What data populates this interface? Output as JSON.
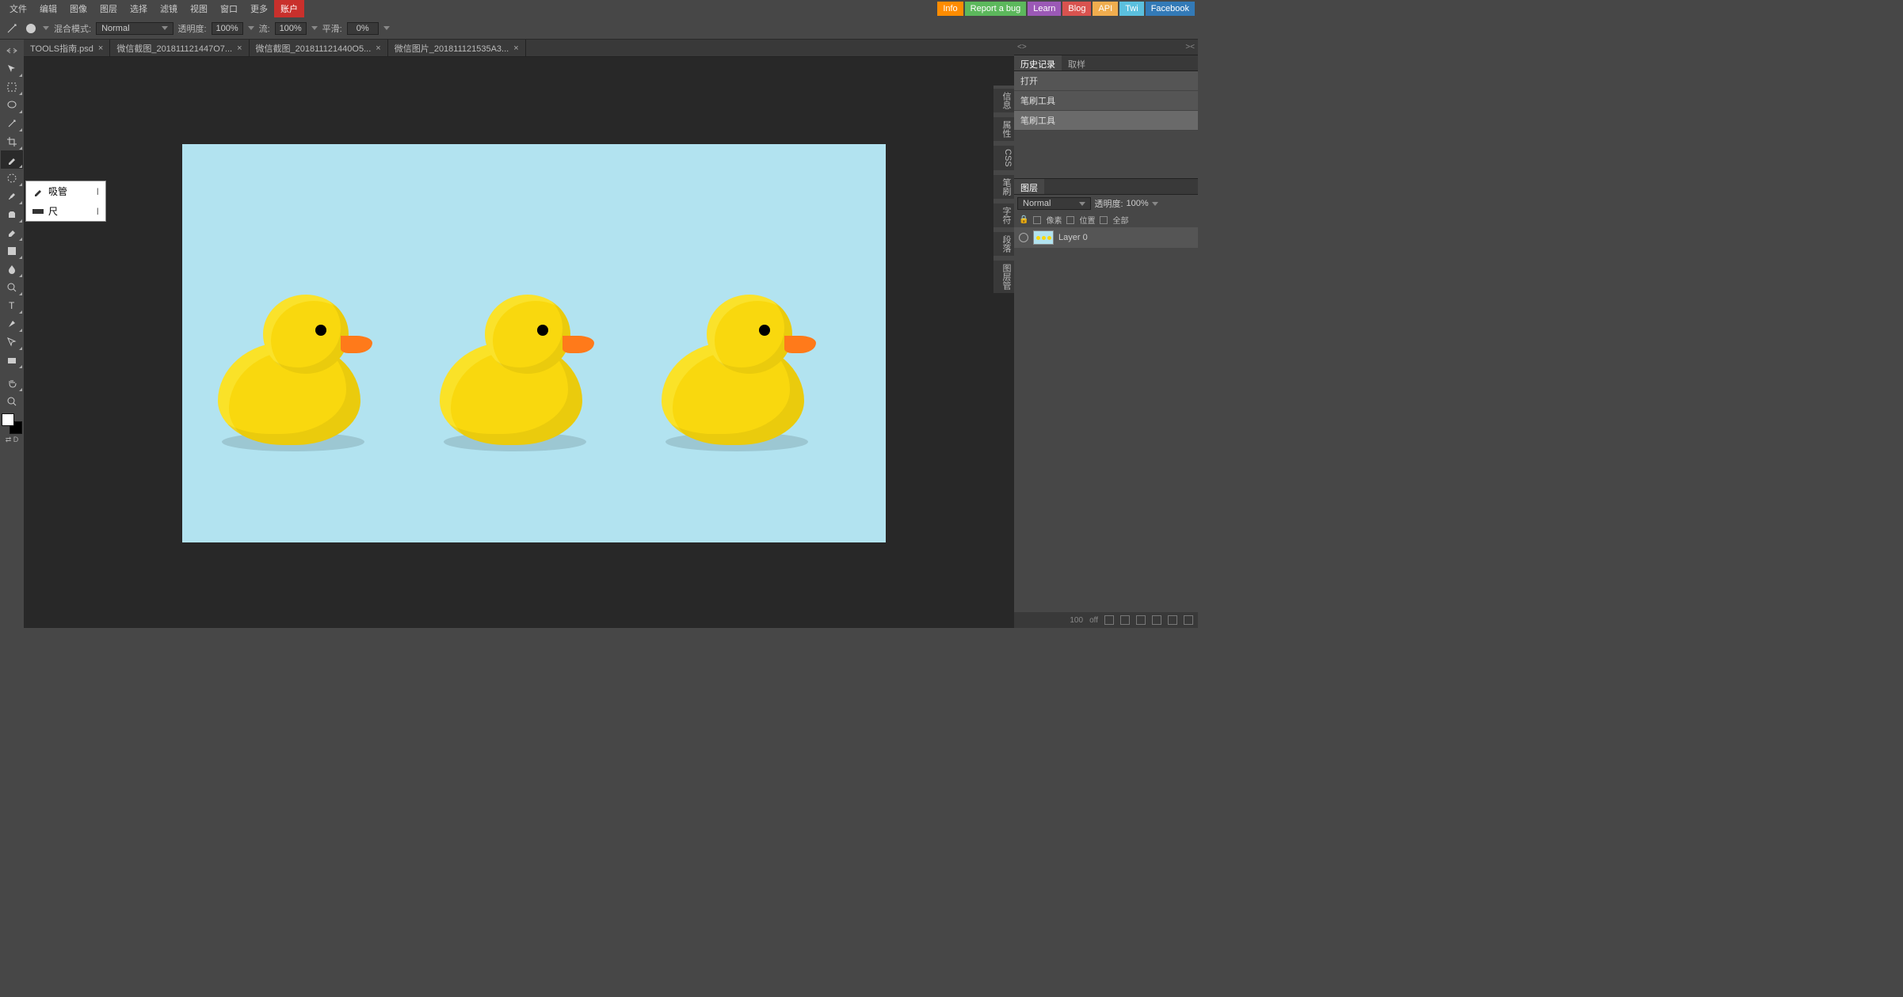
{
  "menu": {
    "items": [
      "文件",
      "编辑",
      "图像",
      "图层",
      "选择",
      "滤镜",
      "视图",
      "窗口",
      "更多"
    ],
    "account": "账户"
  },
  "rightlinks": {
    "info": "Info",
    "bug": "Report a bug",
    "learn": "Learn",
    "blog": "Blog",
    "api": "API",
    "twi": "Twi",
    "fb": "Facebook"
  },
  "optbar": {
    "blend_label": "混合模式:",
    "blend_value": "Normal",
    "opacity_label": "透明度:",
    "opacity_value": "100%",
    "flow_label": "流:",
    "flow_value": "100%",
    "smooth_label": "平滑:",
    "smooth_value": "0%"
  },
  "tabs": [
    {
      "title": "TOOLS指南.psd"
    },
    {
      "title": "微信截图_201811121447O7..."
    },
    {
      "title": "微信截图_201811121440O5..."
    },
    {
      "title": "微信图片_201811121535A3..."
    }
  ],
  "flyout": {
    "items": [
      {
        "label": "吸管",
        "key": "I"
      },
      {
        "label": "尺",
        "key": "I"
      }
    ]
  },
  "sidetabs": [
    "信息",
    "属性",
    "CSS",
    "笔刷",
    "字符",
    "段落",
    "图层管"
  ],
  "history": {
    "tabs": [
      "历史记录",
      "取样"
    ],
    "items": [
      "打开",
      "笔刷工具",
      "笔刷工具"
    ]
  },
  "layerpanel": {
    "tab": "图层",
    "blend": "Normal",
    "opacity_label": "透明度:",
    "opacity_value": "100%",
    "lock_label": "锁:",
    "lock_px": "像素",
    "lock_pos": "位置",
    "lock_all": "全部",
    "layer_name": "Layer 0"
  },
  "footer": {
    "pct": "100",
    "off": "off"
  }
}
